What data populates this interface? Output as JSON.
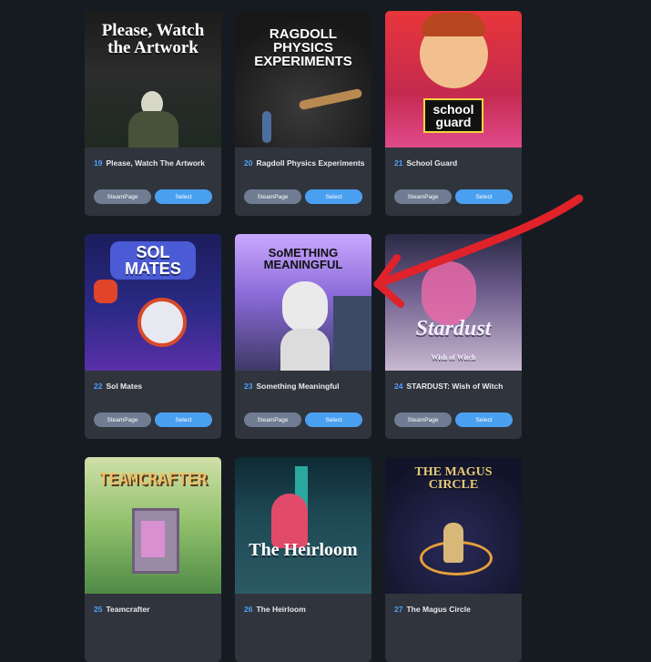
{
  "cards": [
    {
      "num": "19",
      "name": "Please, Watch The Artwork",
      "art_title": "Please, Watch the Artwork",
      "steam_label": "SteamPage",
      "select_label": "Select"
    },
    {
      "num": "20",
      "name": "Ragdoll Physics Experiments",
      "art_title": "RAGDOLL PHYSICS EXPERIMENTS",
      "steam_label": "SteamPage",
      "select_label": "Select"
    },
    {
      "num": "21",
      "name": "School Guard",
      "art_title": "school guard",
      "steam_label": "SteamPage",
      "select_label": "Select"
    },
    {
      "num": "22",
      "name": "Sol Mates",
      "art_title": "SOL MATES",
      "steam_label": "SteamPage",
      "select_label": "Select"
    },
    {
      "num": "23",
      "name": "Something Meaningful",
      "art_title": "SoMETHING MEANINGFUL",
      "steam_label": "SteamPage",
      "select_label": "Select"
    },
    {
      "num": "24",
      "name": "STARDUST: Wish of Witch",
      "art_title": "Stardust",
      "art_subtitle": "Wish of Witch",
      "steam_label": "SteamPage",
      "select_label": "Select"
    },
    {
      "num": "25",
      "name": "Teamcrafter",
      "art_title": "TEAMCRAFTER"
    },
    {
      "num": "26",
      "name": "The Heirloom",
      "art_title": "The Heirloom"
    },
    {
      "num": "27",
      "name": "The Magus Circle",
      "art_title": "THE MAGUS CIRCLE"
    }
  ],
  "colors": {
    "background": "#161b22",
    "card": "#30343c",
    "accent": "#4aa0f0",
    "steam_button": "#6f7c92",
    "annotation_arrow": "#e0222a"
  }
}
